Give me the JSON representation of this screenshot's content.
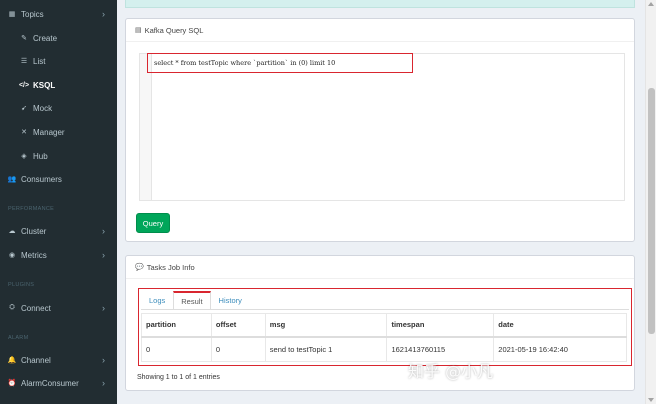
{
  "sidebar": {
    "topics": {
      "label": "Topics",
      "icon": "topics-icon",
      "chevron": "›"
    },
    "create": {
      "label": "Create",
      "icon": "edit-icon"
    },
    "list": {
      "label": "List",
      "icon": "list-icon"
    },
    "ksql": {
      "label": "KSQL",
      "icon": "code-icon"
    },
    "mock": {
      "label": "Mock",
      "icon": "rocket-icon"
    },
    "manager": {
      "label": "Manager",
      "icon": "wrench-icon"
    },
    "hub": {
      "label": "Hub",
      "icon": "cube-icon"
    },
    "consumers": {
      "label": "Consumers",
      "icon": "users-icon"
    },
    "header_performance": "PERFORMANCE",
    "cluster": {
      "label": "Cluster",
      "icon": "cloud-icon",
      "chevron": "›"
    },
    "metrics": {
      "label": "Metrics",
      "icon": "eye-icon",
      "chevron": "›"
    },
    "header_plugins": "PLUGINS",
    "connect": {
      "label": "Connect",
      "icon": "plug-icon",
      "chevron": "›"
    },
    "header_alarm": "ALARM",
    "channel": {
      "label": "Channel",
      "icon": "bell-icon",
      "chevron": "›"
    },
    "alarm_consumer": {
      "label": "AlarmConsumer",
      "icon": "alarm-icon",
      "chevron": "›"
    }
  },
  "query_panel": {
    "title": "Kafka Query SQL",
    "sql": "select * from testTopic where `partition` in (0) limit 10",
    "query_button": "Query"
  },
  "tasks_panel": {
    "title": "Tasks Job Info",
    "tabs": [
      "Logs",
      "Result",
      "History"
    ],
    "active_tab": "Result",
    "columns": [
      "partition",
      "offset",
      "msg",
      "timespan",
      "date"
    ],
    "rows": [
      [
        "0",
        "0",
        "send to testTopic 1",
        "1621413760115",
        "2021-05-19 16:42:40"
      ]
    ],
    "entries_text": "Showing 1 to 1 of 1 entries"
  },
  "watermark": "知乎 @小凡",
  "colors": {
    "sidebar_bg": "#222d32",
    "accent_red": "#d9262f",
    "button_green": "#00a65a",
    "link_blue": "#3c8dbc"
  }
}
